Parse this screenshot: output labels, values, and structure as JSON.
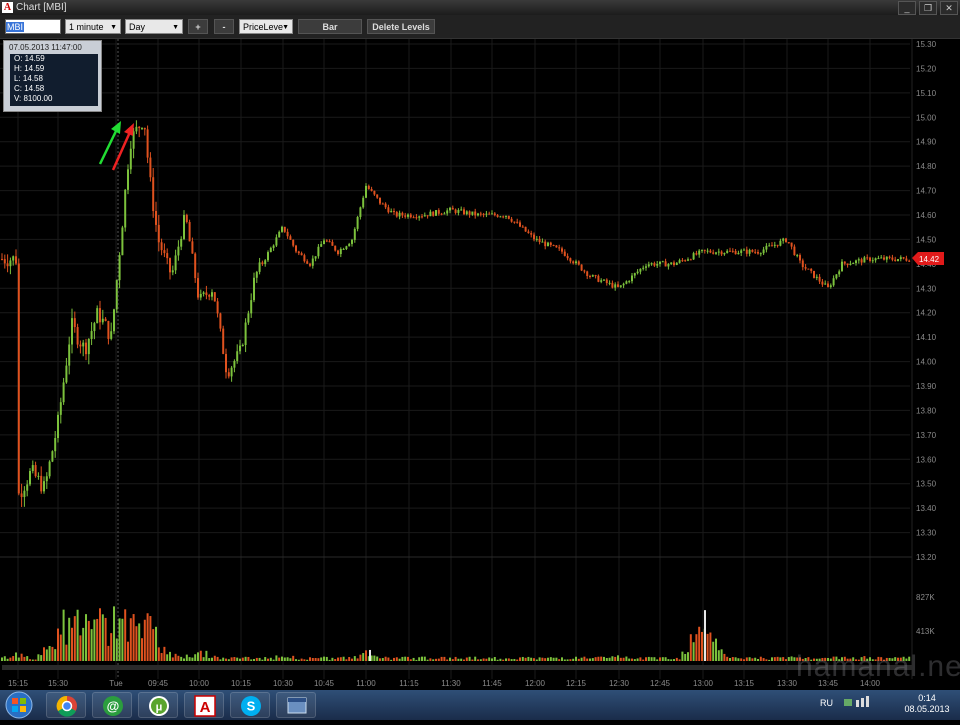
{
  "window": {
    "title": "Chart [MBI]",
    "logo_glyph": "A",
    "controls": [
      "_",
      "❐",
      "✕"
    ]
  },
  "toolbar": {
    "symbol": "MBI",
    "interval": "1 minute",
    "range": "Day",
    "plus_label": "+",
    "minus_label": "-",
    "tool": "PriceLeve",
    "bar_label": "Bar",
    "delete_levels_label": "Delete Levels"
  },
  "tooltip": {
    "date": "07.05.2013 11:47:00",
    "open": "O: 14.59",
    "high": "H: 14.59",
    "low": "L: 14.58",
    "close": "C: 14.58",
    "volume": "V: 8100.00"
  },
  "chart_data": {
    "type": "candlestick",
    "symbol": "MBI",
    "price_axis": {
      "ticks": [
        "15.30",
        "15.20",
        "15.10",
        "15.00",
        "14.90",
        "14.80",
        "14.70",
        "14.60",
        "14.50",
        "14.40",
        "14.30",
        "14.20",
        "14.10",
        "14.00",
        "13.90",
        "13.80",
        "13.70",
        "13.60",
        "13.50",
        "13.40",
        "13.30",
        "13.20"
      ],
      "ylim": [
        13.2,
        15.3
      ]
    },
    "volume_axis": {
      "ticks": [
        "827K",
        "413K"
      ]
    },
    "time_axis": {
      "ticks": [
        "15:15",
        "15:30",
        "Tue",
        "09:45",
        "10:00",
        "10:15",
        "10:30",
        "10:45",
        "11:00",
        "11:15",
        "11:30",
        "11:45",
        "12:00",
        "12:15",
        "12:30",
        "12:45",
        "13:00",
        "13:15",
        "13:30",
        "13:45",
        "14:00"
      ]
    },
    "last_price": "14.42",
    "price_path": [
      [
        "15:15",
        13.45
      ],
      [
        "15:20",
        13.55
      ],
      [
        "15:25",
        13.48
      ],
      [
        "15:30",
        13.75
      ],
      [
        "15:35",
        14.15
      ],
      [
        "15:40",
        14.05
      ],
      [
        "15:45",
        14.2
      ],
      [
        "15:50",
        14.1
      ],
      [
        "09:30",
        14.3
      ],
      [
        "09:35",
        14.9
      ],
      [
        "09:40",
        15.0
      ],
      [
        "09:42",
        14.75
      ],
      [
        "09:45",
        14.5
      ],
      [
        "09:50",
        14.35
      ],
      [
        "09:55",
        14.6
      ],
      [
        "10:00",
        14.25
      ],
      [
        "10:05",
        14.3
      ],
      [
        "10:10",
        13.95
      ],
      [
        "10:15",
        14.05
      ],
      [
        "10:20",
        14.35
      ],
      [
        "10:25",
        14.45
      ],
      [
        "10:30",
        14.55
      ],
      [
        "10:35",
        14.45
      ],
      [
        "10:40",
        14.4
      ],
      [
        "10:45",
        14.5
      ],
      [
        "10:50",
        14.45
      ],
      [
        "10:55",
        14.5
      ],
      [
        "11:00",
        14.72
      ],
      [
        "11:05",
        14.65
      ],
      [
        "11:10",
        14.6
      ],
      [
        "11:15",
        14.6
      ],
      [
        "11:20",
        14.6
      ],
      [
        "11:30",
        14.62
      ],
      [
        "11:40",
        14.6
      ],
      [
        "11:50",
        14.6
      ],
      [
        "12:00",
        14.5
      ],
      [
        "12:10",
        14.45
      ],
      [
        "12:20",
        14.35
      ],
      [
        "12:30",
        14.3
      ],
      [
        "12:40",
        14.4
      ],
      [
        "12:50",
        14.4
      ],
      [
        "13:00",
        14.45
      ],
      [
        "13:10",
        14.45
      ],
      [
        "13:20",
        14.45
      ],
      [
        "13:30",
        14.5
      ],
      [
        "13:35",
        14.4
      ],
      [
        "13:45",
        14.3
      ],
      [
        "13:50",
        14.4
      ],
      [
        "14:00",
        14.42
      ],
      [
        "14:10",
        14.42
      ]
    ],
    "volume_profile": [
      [
        "15:15",
        0.1
      ],
      [
        "15:30",
        0.3
      ],
      [
        "09:35",
        0.6
      ],
      [
        "09:40",
        0.75
      ],
      [
        "09:45",
        0.3
      ],
      [
        "10:00",
        0.15
      ],
      [
        "10:30",
        0.08
      ],
      [
        "11:00",
        0.1
      ],
      [
        "11:30",
        0.05
      ],
      [
        "12:00",
        0.05
      ],
      [
        "12:30",
        0.06
      ],
      [
        "13:00",
        0.05
      ],
      [
        "13:00",
        0.57
      ],
      [
        "13:30",
        0.06
      ],
      [
        "14:00",
        0.06
      ]
    ],
    "colors": {
      "up": "#7cc23c",
      "down": "#e0521f",
      "grid": "#1a1a1a",
      "axis_text": "#8a8a8a",
      "last_price_bg": "#e11a1a",
      "arrow_up": "#22dd33",
      "arrow_down": "#ee2222"
    }
  },
  "taskbar": {
    "apps": [
      "start-orb",
      "chrome",
      "@",
      "utorrent",
      "A",
      "skype",
      "window"
    ],
    "tray": {
      "lang": "RU",
      "time": "0:14",
      "date": "08.05.2013"
    }
  },
  "watermark": "hamanal.net"
}
